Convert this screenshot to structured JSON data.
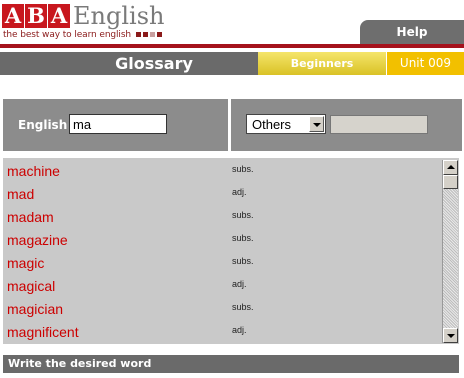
{
  "brand": {
    "logo_letters": [
      "A",
      "B",
      "A"
    ],
    "logo_word": "English",
    "tagline": "the best way to learn english"
  },
  "header": {
    "help_label": "Help",
    "title": "Glossary",
    "level": "Beginners",
    "unit": "Unit 009"
  },
  "search": {
    "label": "English",
    "value": "ma",
    "category_selected": "Others",
    "secondary_value": ""
  },
  "word_list": {
    "rows": [
      {
        "word": "machine",
        "pos": "subs."
      },
      {
        "word": "mad",
        "pos": "adj."
      },
      {
        "word": "madam",
        "pos": "subs."
      },
      {
        "word": "magazine",
        "pos": "subs."
      },
      {
        "word": "magic",
        "pos": "subs."
      },
      {
        "word": "magical",
        "pos": "adj."
      },
      {
        "word": "magician",
        "pos": "subs."
      },
      {
        "word": "magnificent",
        "pos": "adj."
      }
    ]
  },
  "status": {
    "message": "Write the desired word"
  },
  "colors": {
    "brand_red": "#c8171e",
    "word_red": "#cc0000",
    "level_yellow": "#e6d236",
    "unit_yellow": "#f2c000",
    "panel_gray": "#8c8c8c",
    "list_gray": "#c9c9c9"
  }
}
